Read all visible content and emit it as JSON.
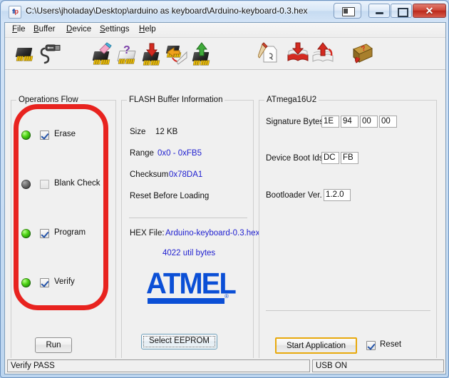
{
  "window": {
    "title": "C:\\Users\\jholaday\\Desktop\\arduino as keyboard\\Arduino-keyboard-0.3.hex",
    "icon": "flip-app-icon",
    "buttons": {
      "extra": "restore-group-icon",
      "minimize": "minimize-icon",
      "maximize": "maximize-icon",
      "close": "✕"
    }
  },
  "menu": [
    {
      "label": "File"
    },
    {
      "label": "Buffer"
    },
    {
      "label": "Device"
    },
    {
      "label": "Settings"
    },
    {
      "label": "Help"
    }
  ],
  "toolbar": [
    {
      "name": "select-device-chip-icon",
      "title": "Select Device"
    },
    {
      "name": "usb-cable-icon",
      "title": "USB Connection"
    },
    {
      "name": "erase-chip-icon",
      "title": "Erase Device"
    },
    {
      "name": "blank-check-chip-icon",
      "title": "Blank Check"
    },
    {
      "name": "program-chip-icon",
      "title": "Program Device"
    },
    {
      "name": "read-chip-to-file-icon",
      "title": "Read Device"
    },
    {
      "name": "verify-chip-icon",
      "title": "Verify Device"
    },
    {
      "name": "new-file-icon",
      "title": "New Buffer"
    },
    {
      "name": "open-hex-file-icon",
      "title": "Load HEX File"
    },
    {
      "name": "save-hex-file-icon",
      "title": "Save HEX File"
    },
    {
      "name": "help-book-icon",
      "title": "Help"
    }
  ],
  "operations": {
    "legend": "Operations Flow",
    "items": [
      {
        "label": "Erase",
        "checked": true,
        "led": "on"
      },
      {
        "label": "Blank Check",
        "checked": false,
        "led": "off"
      },
      {
        "label": "Program",
        "checked": true,
        "led": "on"
      },
      {
        "label": "Verify",
        "checked": true,
        "led": "on"
      }
    ],
    "run_label": "Run",
    "annotation_color": "#e8231f"
  },
  "flash": {
    "legend": "FLASH Buffer Information",
    "size_label": "Size",
    "size_value": "12 KB",
    "range_label": "Range",
    "range_value": "0x0 - 0xFB5",
    "checksum_label": "Checksum",
    "checksum_value": "0x78DA1",
    "reset_before_loading": "Reset Before Loading",
    "hex_file_label": "HEX File:",
    "hex_file_value": "Arduino-keyboard-0.3.hex",
    "util_bytes": "4022 util bytes",
    "logo_text": "ATMEL",
    "logo_reg": "®",
    "logo_color": "#0b4fd6",
    "select_eeprom_label": "Select EEPROM",
    "value_color": "#2020d0"
  },
  "device": {
    "legend": "ATmega16U2",
    "signature_label": "Signature Bytes",
    "signature_bytes": [
      "1E",
      "94",
      "00",
      "00"
    ],
    "boot_ids_label": "Device Boot Ids",
    "boot_ids": [
      "DC",
      "FB"
    ],
    "bootloader_label": "Bootloader Ver.",
    "bootloader_value": "1.2.0",
    "start_application_label": "Start Application",
    "start_application_highlight": "#e8a90c",
    "reset_label": "Reset",
    "reset_checked": true
  },
  "statusbar": {
    "left": "Verify PASS",
    "right": "USB ON"
  }
}
